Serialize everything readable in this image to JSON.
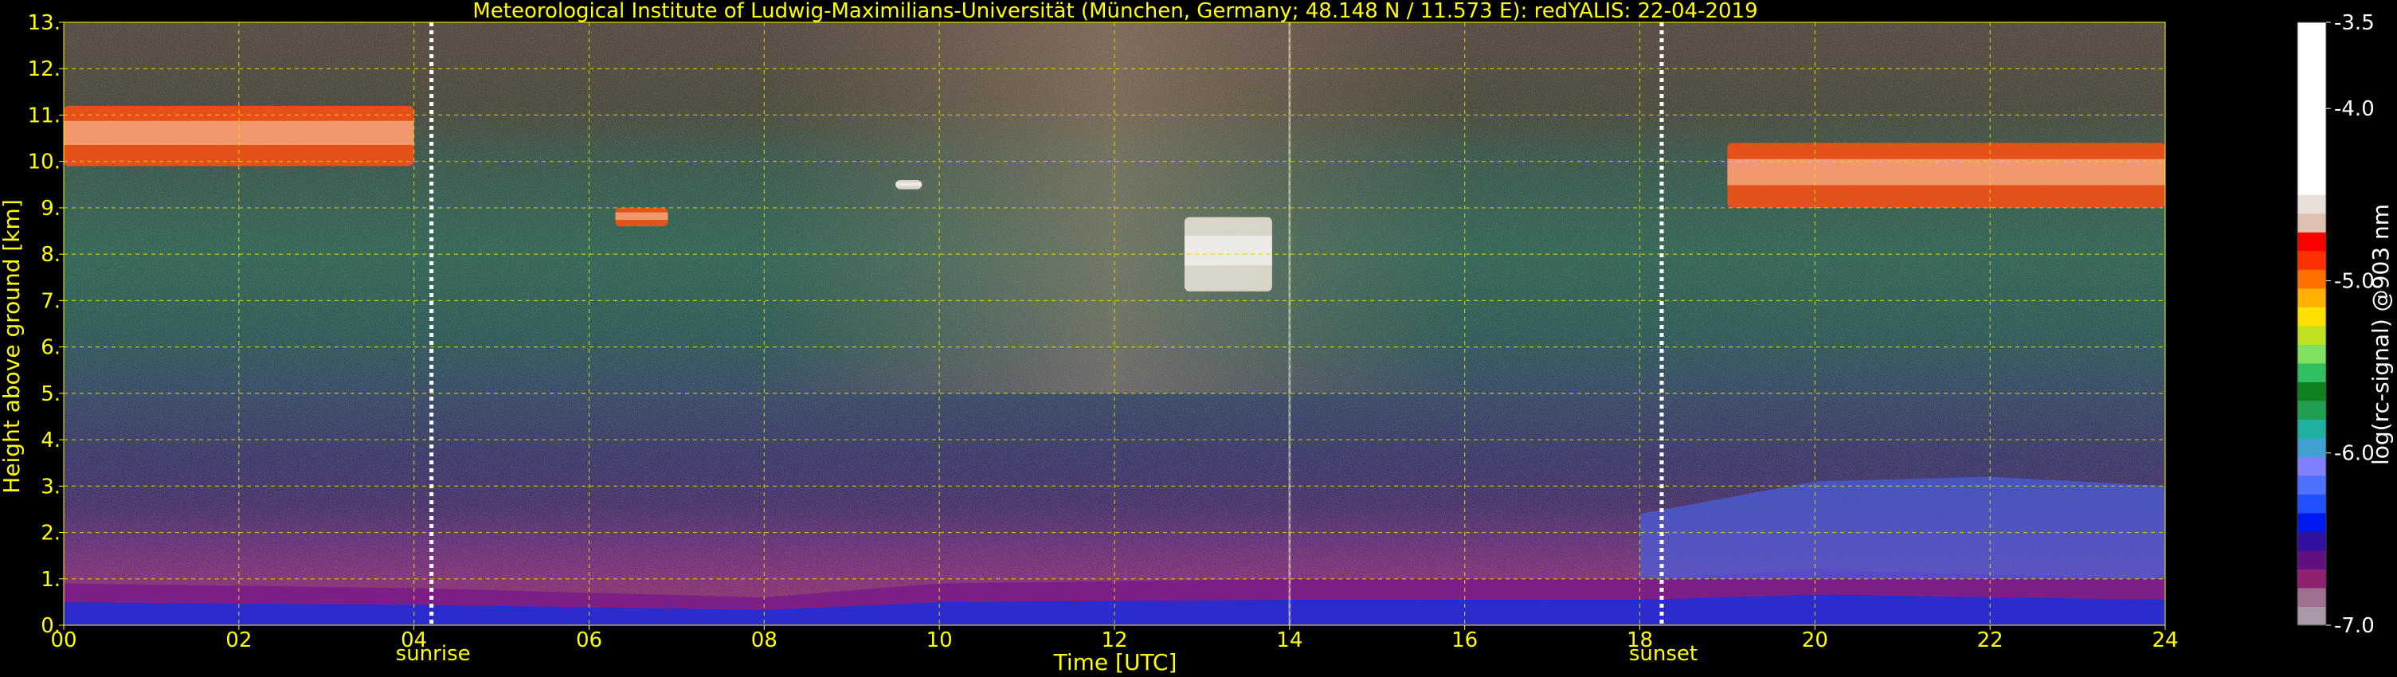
{
  "chart_data": {
    "type": "heatmap",
    "title": "Meteorological Institute of Ludwig-Maximilians-Universität (München, Germany; 48.148 N / 11.573 E):    redYALIS: 22-04-2019",
    "xlabel": "Time [UTC]",
    "ylabel": "Height above ground [km]",
    "colorbar_label": "log(rc-signal) @903 nm",
    "xlim": [
      0,
      24
    ],
    "ylim": [
      0,
      13
    ],
    "x_ticks": [
      "00",
      "02",
      "04",
      "06",
      "08",
      "10",
      "12",
      "14",
      "16",
      "18",
      "20",
      "22",
      "24"
    ],
    "x_tick_values": [
      0,
      2,
      4,
      6,
      8,
      10,
      12,
      14,
      16,
      18,
      20,
      22,
      24
    ],
    "y_ticks": [
      "0.",
      "1.",
      "2.",
      "3.",
      "4.",
      "5.",
      "6.",
      "7.",
      "8.",
      "9.",
      "10.",
      "11.",
      "12.",
      "13."
    ],
    "y_tick_values": [
      0,
      1,
      2,
      3,
      4,
      5,
      6,
      7,
      8,
      9,
      10,
      11,
      12,
      13
    ],
    "colorbar_range": [
      -7.0,
      -3.5
    ],
    "colorbar_ticks": [
      "-3.5",
      "-4.0",
      "-5.0",
      "-6.0",
      "-7.0"
    ],
    "colorbar_tick_values": [
      -3.5,
      -4.0,
      -5.0,
      -6.0,
      -7.0
    ],
    "colorscale": [
      "#a898a8",
      "#a07090",
      "#902070",
      "#601080",
      "#3010a0",
      "#0018f0",
      "#2050ff",
      "#5070ff",
      "#8080ff",
      "#40a0d0",
      "#20b0a0",
      "#20a050",
      "#108020",
      "#30c060",
      "#80e060",
      "#c0e020",
      "#ffe000",
      "#ffb000",
      "#ff7000",
      "#ff3000",
      "#ff0000",
      "#e0c0b0",
      "#e8e0d8",
      "#ffffff"
    ],
    "events": [
      {
        "label": "sunrise",
        "time": 4.2
      },
      {
        "label": "sunset",
        "time": 18.25
      }
    ],
    "markers": [
      {
        "time": 14.0
      }
    ],
    "grid": true,
    "cloud_layers": [
      {
        "start": 0.0,
        "end": 4.0,
        "bottom_km": 9.9,
        "top_km": 11.2
      },
      {
        "start": 6.3,
        "end": 6.9,
        "bottom_km": 8.6,
        "top_km": 9.0
      },
      {
        "start": 9.5,
        "end": 9.8,
        "bottom_km": 9.4,
        "top_km": 9.6
      },
      {
        "start": 12.8,
        "end": 13.8,
        "bottom_km": 7.2,
        "top_km": 8.8
      },
      {
        "start": 19.0,
        "end": 24.0,
        "bottom_km": 9.0,
        "top_km": 10.4
      }
    ],
    "boundary_layer": [
      {
        "time": 0,
        "top_km": 0.9
      },
      {
        "time": 4,
        "top_km": 0.8
      },
      {
        "time": 8,
        "top_km": 0.6
      },
      {
        "time": 10,
        "top_km": 0.9
      },
      {
        "time": 14,
        "top_km": 1.0
      },
      {
        "time": 18,
        "top_km": 1.0
      },
      {
        "time": 20,
        "top_km": 1.2
      },
      {
        "time": 24,
        "top_km": 1.0
      }
    ],
    "residual_layer": [
      {
        "time": 18.0,
        "top_km": 2.4
      },
      {
        "time": 20.0,
        "top_km": 3.1
      },
      {
        "time": 22.0,
        "top_km": 3.2
      },
      {
        "time": 24.0,
        "top_km": 3.0
      }
    ]
  }
}
